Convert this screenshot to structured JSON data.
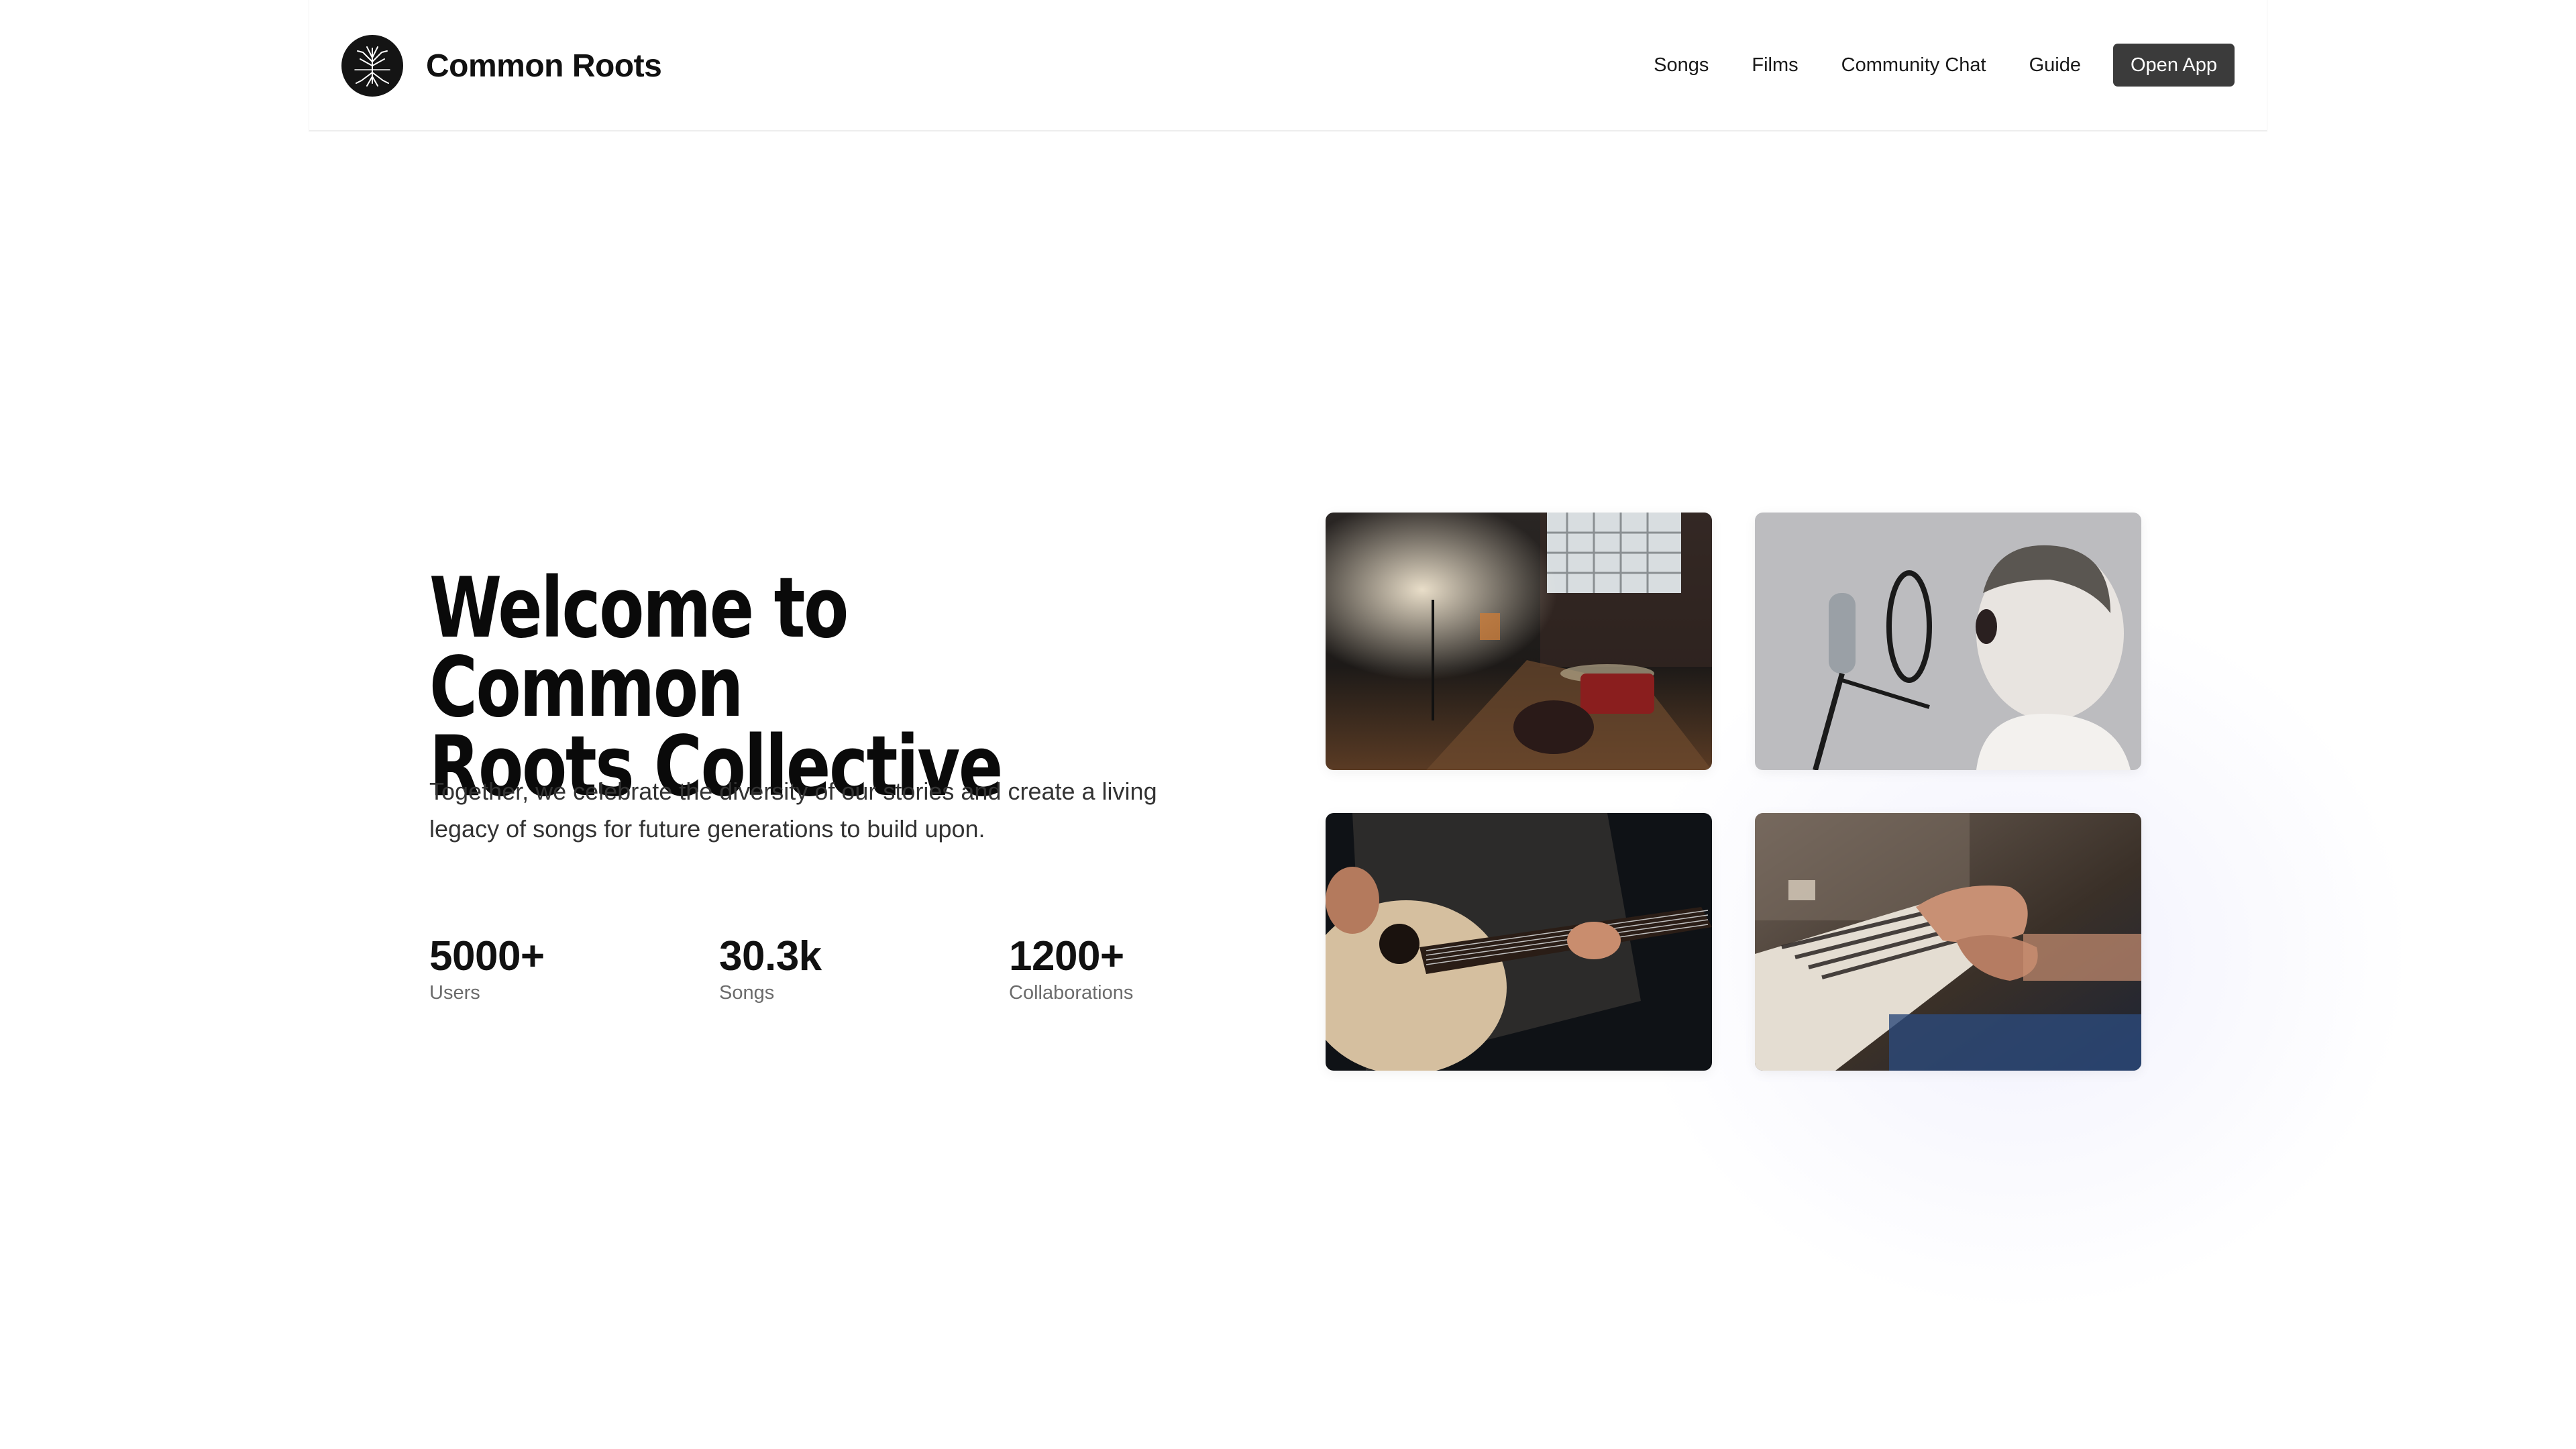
{
  "header": {
    "brand_name": "Common Roots",
    "logo_icon": "tree-roots-icon",
    "nav": [
      {
        "label": "Songs"
      },
      {
        "label": "Films"
      },
      {
        "label": "Community Chat"
      },
      {
        "label": "Guide"
      }
    ],
    "cta_label": "Open App"
  },
  "hero": {
    "title_line1": "Welcome to Common",
    "title_line2": "Roots Collective",
    "subtitle_line1": "Together, we celebrate the diversity of our stories and create a living",
    "subtitle_line2": "legacy of songs for future generations to build upon."
  },
  "stats": [
    {
      "value": "5000+",
      "label": "Users"
    },
    {
      "value": "30.3k",
      "label": "Songs"
    },
    {
      "value": "1200+",
      "label": "Collaborations"
    }
  ],
  "gallery": [
    {
      "subject": "stage-with-drum-kit-photo"
    },
    {
      "subject": "boy-singing-into-microphone-photo"
    },
    {
      "subject": "acoustic-guitar-player-photo"
    },
    {
      "subject": "hands-playing-piano-photo"
    }
  ],
  "colors": {
    "cta_background": "#3b3b3b",
    "text_primary": "#111111",
    "text_muted": "#6b6b6b"
  }
}
